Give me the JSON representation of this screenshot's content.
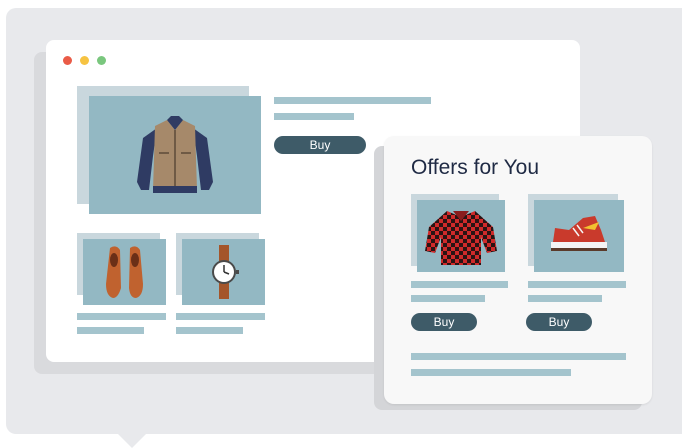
{
  "browser": {
    "window_controls": [
      "close",
      "minimize",
      "maximize"
    ],
    "colors": {
      "close": "#ea5b47",
      "minimize": "#f6c342",
      "maximize": "#7ac77e"
    },
    "featured_product": {
      "image": "jacket-icon",
      "buy_label": "Buy"
    },
    "products": [
      {
        "image": "shoes-icon"
      },
      {
        "image": "watch-icon"
      }
    ]
  },
  "offers": {
    "title": "Offers for You",
    "items": [
      {
        "image": "shirt-icon",
        "buy_label": "Buy"
      },
      {
        "image": "sneaker-icon",
        "buy_label": "Buy"
      }
    ]
  },
  "colors": {
    "backdrop": "#e8e9ec",
    "image_bg": "#93b8c3",
    "image_shadow": "#c9d7dd",
    "text_line": "#a4c4cd",
    "button": "#3e5b68",
    "title": "#1f2a44"
  }
}
